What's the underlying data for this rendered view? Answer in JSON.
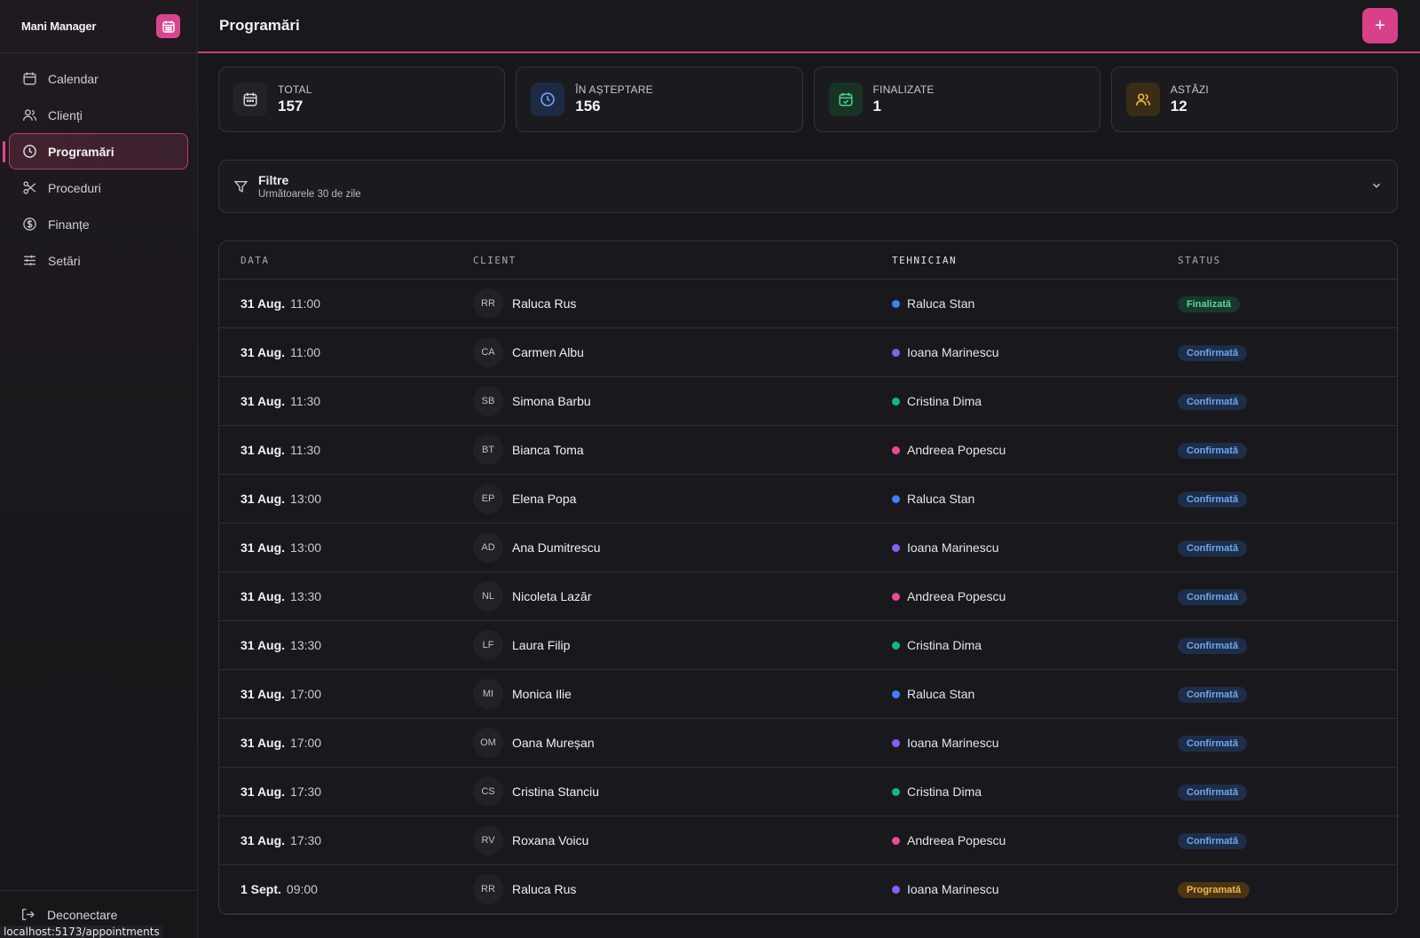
{
  "sidebar": {
    "brand": "Mani Manager",
    "items": [
      {
        "label": "Calendar",
        "icon": "calendar-icon"
      },
      {
        "label": "Clienți",
        "icon": "users-icon"
      },
      {
        "label": "Programări",
        "icon": "clock-icon",
        "active": true
      },
      {
        "label": "Proceduri",
        "icon": "scissors-icon"
      },
      {
        "label": "Finanțe",
        "icon": "dollar-circle-icon"
      },
      {
        "label": "Setări",
        "icon": "sliders-icon"
      }
    ],
    "logout": "Deconectare",
    "url_tooltip": "localhost:5173/appointments"
  },
  "header": {
    "title": "Programări",
    "add_label": "+"
  },
  "stats": [
    {
      "label": "TOTAL",
      "value": "157",
      "color": "#e8e8ec"
    },
    {
      "label": "ÎN AȘTEPTARE",
      "value": "156",
      "color": "#6ea6f0"
    },
    {
      "label": "FINALIZATE",
      "value": "1",
      "color": "#4fcf8e"
    },
    {
      "label": "ASTĂZI",
      "value": "12",
      "color": "#f0b84b"
    }
  ],
  "filters": {
    "title": "Filtre",
    "subtitle": "Următoarele 30 de zile"
  },
  "table": {
    "columns": [
      "DATA",
      "CLIENT",
      "TEHNICIAN",
      "STATUS"
    ],
    "rows": [
      {
        "day": "31 Aug.",
        "time": "11:00",
        "initials": "RR",
        "client": "Raluca Rus",
        "tech": "Raluca Stan",
        "tech_color": "#3b82f6",
        "status": "Finalizată",
        "kind": "done"
      },
      {
        "day": "31 Aug.",
        "time": "11:00",
        "initials": "CA",
        "client": "Carmen Albu",
        "tech": "Ioana Marinescu",
        "tech_color": "#8b5cf6",
        "status": "Confirmată",
        "kind": "conf"
      },
      {
        "day": "31 Aug.",
        "time": "11:30",
        "initials": "SB",
        "client": "Simona Barbu",
        "tech": "Cristina Dima",
        "tech_color": "#10b981",
        "status": "Confirmată",
        "kind": "conf"
      },
      {
        "day": "31 Aug.",
        "time": "11:30",
        "initials": "BT",
        "client": "Bianca Toma",
        "tech": "Andreea Popescu",
        "tech_color": "#ec4899",
        "status": "Confirmată",
        "kind": "conf"
      },
      {
        "day": "31 Aug.",
        "time": "13:00",
        "initials": "EP",
        "client": "Elena Popa",
        "tech": "Raluca Stan",
        "tech_color": "#3b82f6",
        "status": "Confirmată",
        "kind": "conf"
      },
      {
        "day": "31 Aug.",
        "time": "13:00",
        "initials": "AD",
        "client": "Ana Dumitrescu",
        "tech": "Ioana Marinescu",
        "tech_color": "#8b5cf6",
        "status": "Confirmată",
        "kind": "conf"
      },
      {
        "day": "31 Aug.",
        "time": "13:30",
        "initials": "NL",
        "client": "Nicoleta Lazăr",
        "tech": "Andreea Popescu",
        "tech_color": "#ec4899",
        "status": "Confirmată",
        "kind": "conf"
      },
      {
        "day": "31 Aug.",
        "time": "13:30",
        "initials": "LF",
        "client": "Laura Filip",
        "tech": "Cristina Dima",
        "tech_color": "#10b981",
        "status": "Confirmată",
        "kind": "conf"
      },
      {
        "day": "31 Aug.",
        "time": "17:00",
        "initials": "MI",
        "client": "Monica Ilie",
        "tech": "Raluca Stan",
        "tech_color": "#3b82f6",
        "status": "Confirmată",
        "kind": "conf"
      },
      {
        "day": "31 Aug.",
        "time": "17:00",
        "initials": "OM",
        "client": "Oana Mureșan",
        "tech": "Ioana Marinescu",
        "tech_color": "#8b5cf6",
        "status": "Confirmată",
        "kind": "conf"
      },
      {
        "day": "31 Aug.",
        "time": "17:30",
        "initials": "CS",
        "client": "Cristina Stanciu",
        "tech": "Cristina Dima",
        "tech_color": "#10b981",
        "status": "Confirmată",
        "kind": "conf"
      },
      {
        "day": "31 Aug.",
        "time": "17:30",
        "initials": "RV",
        "client": "Roxana Voicu",
        "tech": "Andreea Popescu",
        "tech_color": "#ec4899",
        "status": "Confirmată",
        "kind": "conf"
      },
      {
        "day": "1 Sept.",
        "time": "09:00",
        "initials": "RR",
        "client": "Raluca Rus",
        "tech": "Ioana Marinescu",
        "tech_color": "#8b5cf6",
        "status": "Programată",
        "kind": "prog"
      }
    ]
  }
}
